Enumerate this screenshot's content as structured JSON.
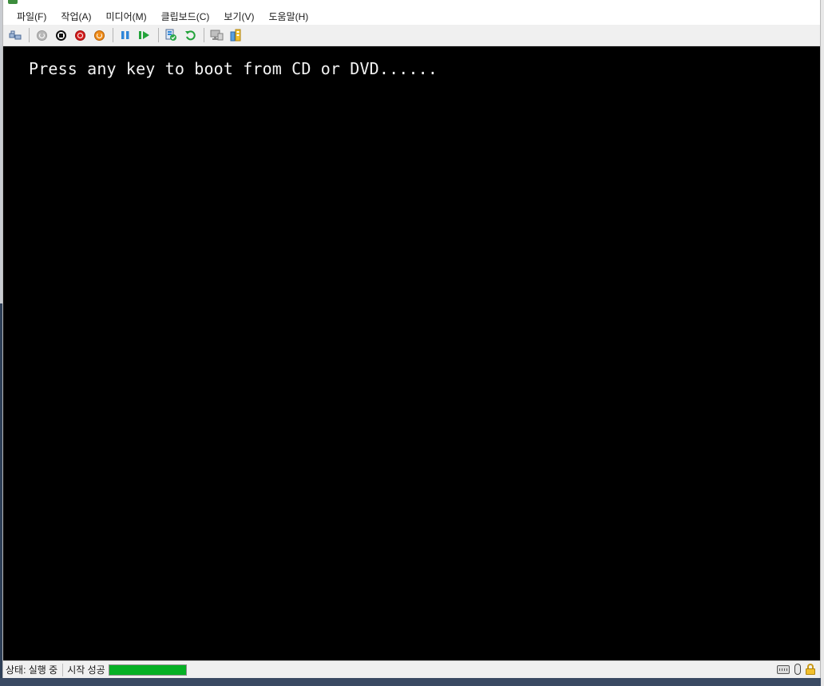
{
  "menubar": {
    "items": [
      "파일(F)",
      "작업(A)",
      "미디어(M)",
      "클립보드(C)",
      "보기(V)",
      "도움말(H)"
    ]
  },
  "toolbar": {
    "buttons": [
      {
        "icon": "ctrl-alt-del-icon"
      },
      {
        "icon": "start-icon"
      },
      {
        "icon": "turn-off-icon"
      },
      {
        "icon": "shut-down-icon"
      },
      {
        "icon": "save-icon"
      },
      {
        "icon": "pause-icon"
      },
      {
        "icon": "resume-icon"
      },
      {
        "icon": "checkpoint-icon"
      },
      {
        "icon": "revert-icon"
      },
      {
        "icon": "enhanced-session-icon"
      },
      {
        "icon": "share-icon"
      }
    ]
  },
  "console": {
    "boot_message": "Press any key to boot from CD or DVD......"
  },
  "statusbar": {
    "status": "상태: 실행 중",
    "progress_label": "시작 성공",
    "progress_fraction": 1.0
  },
  "colors": {
    "console_background": "#000000",
    "console_text": "#f2f2f2",
    "progress_fill": "#06b025"
  }
}
